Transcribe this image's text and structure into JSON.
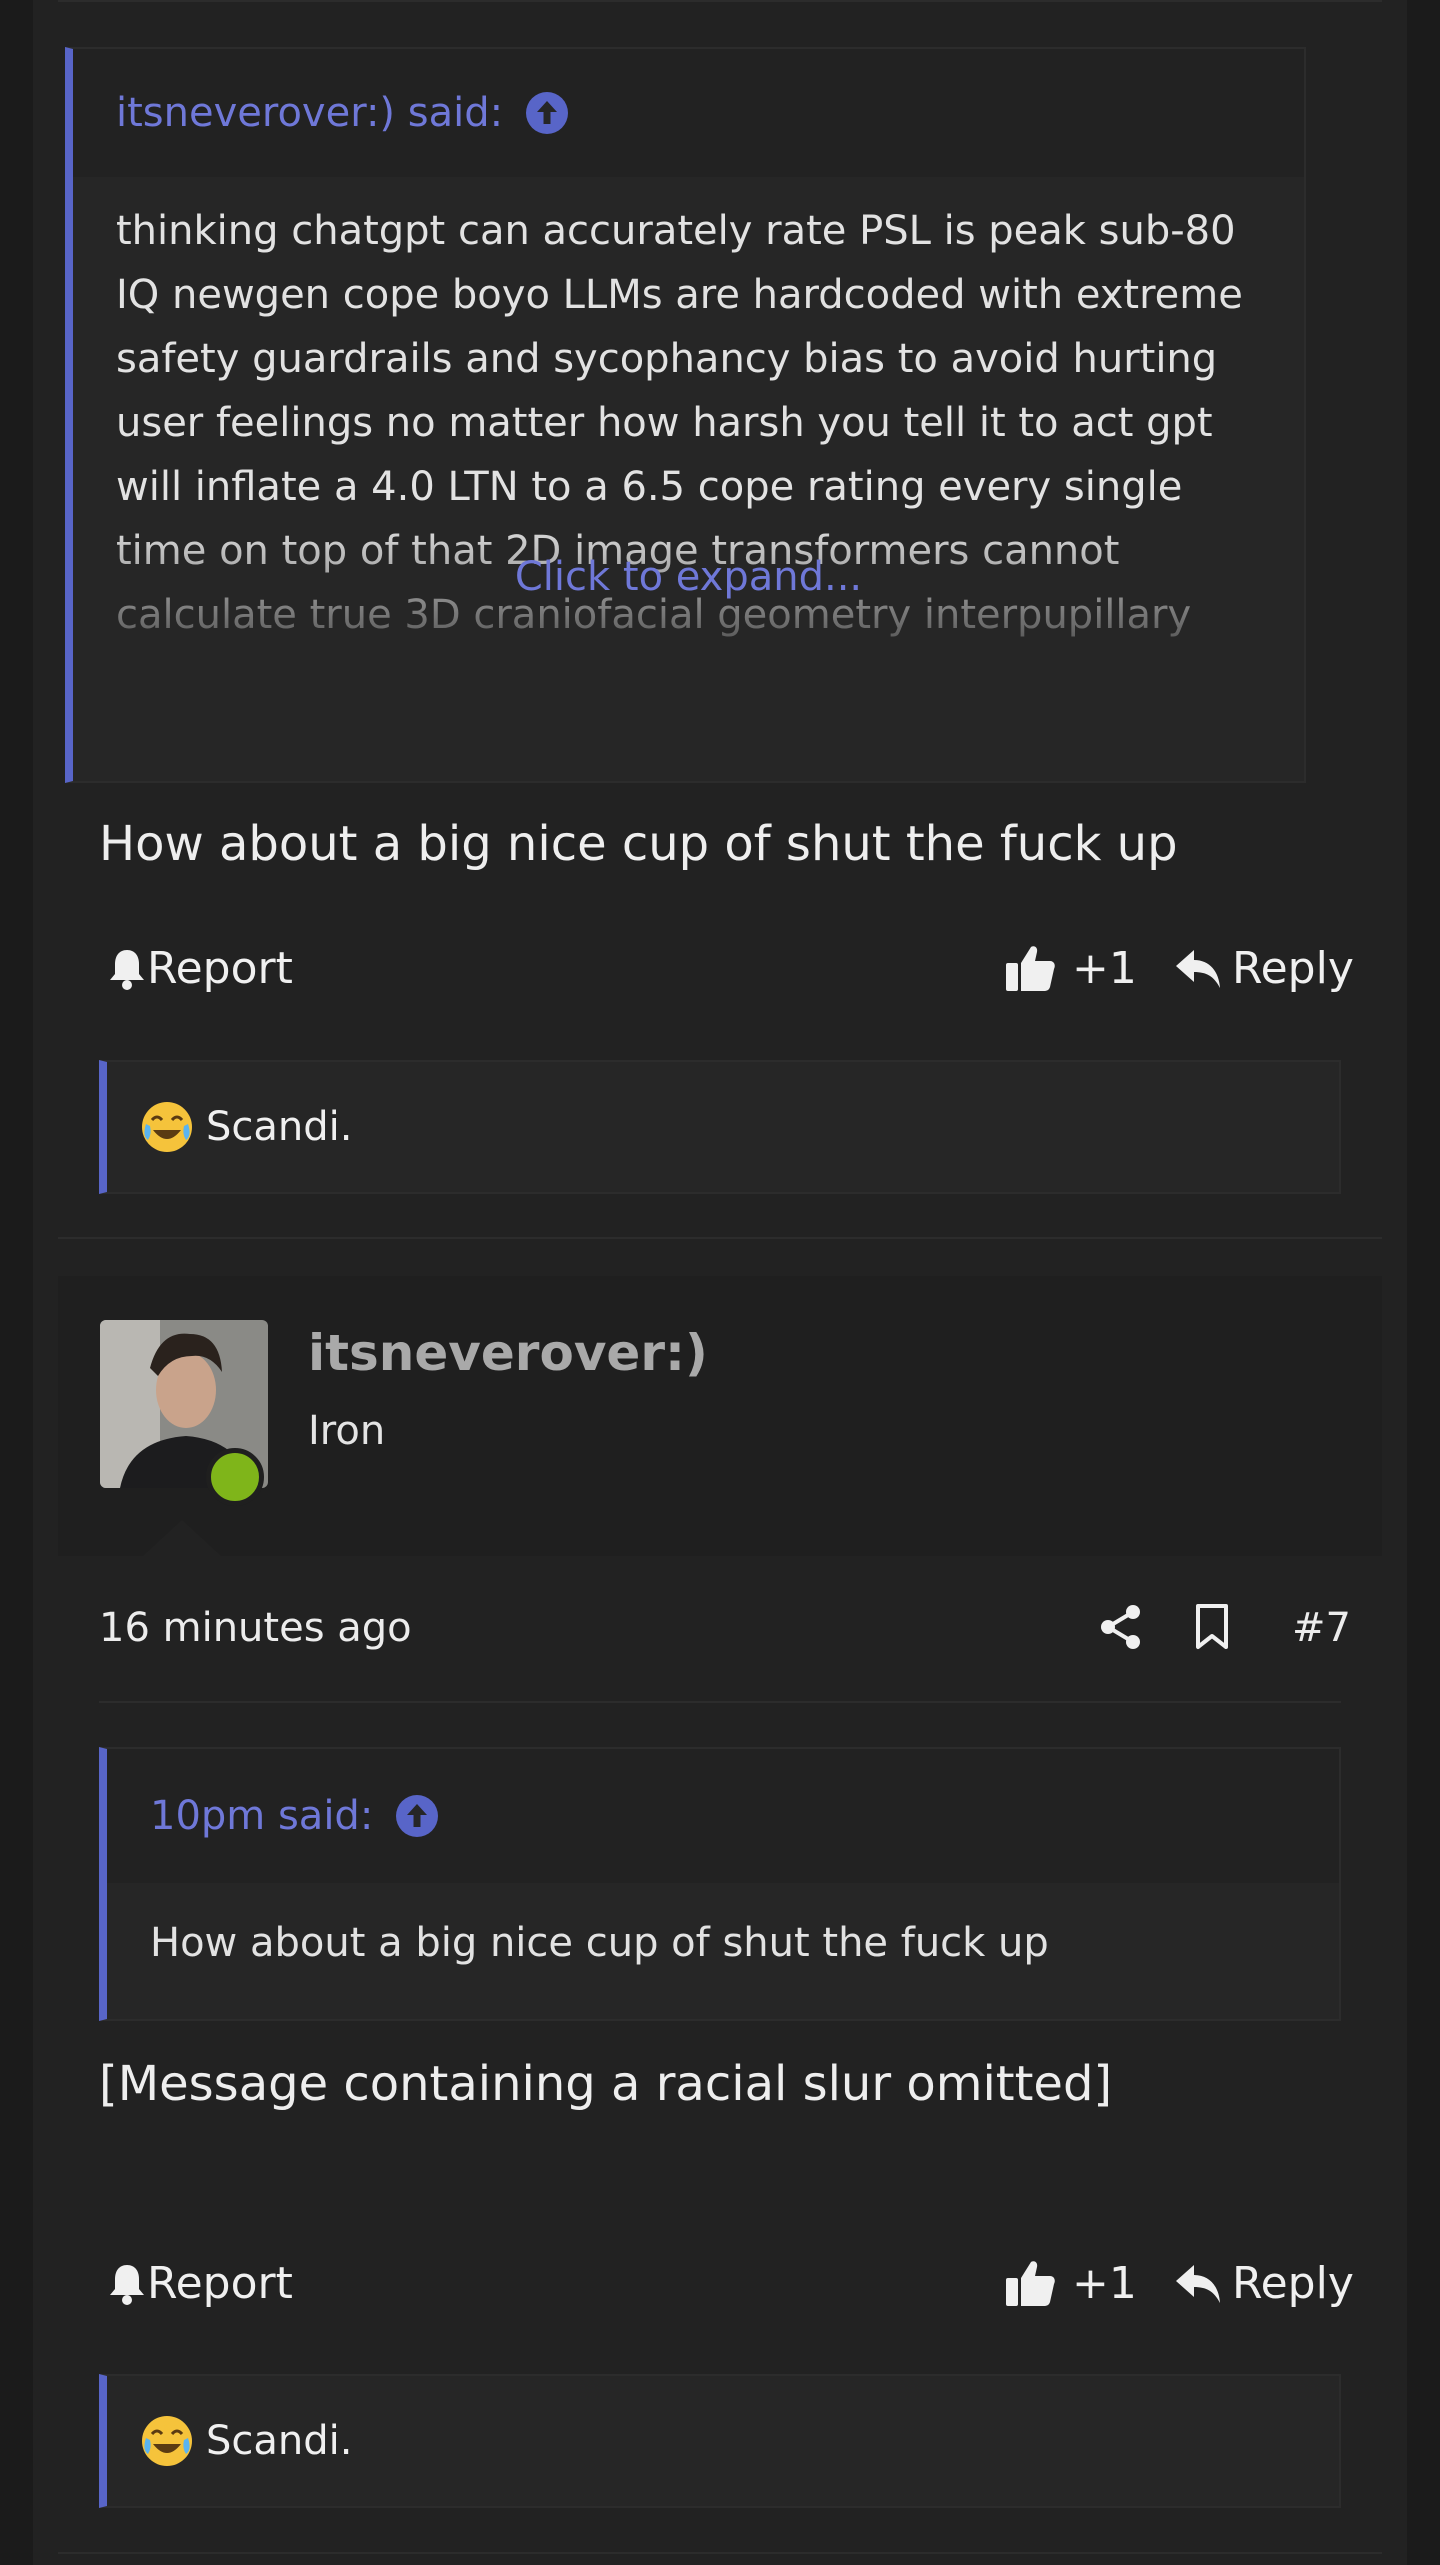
{
  "post1": {
    "quote": {
      "author_label": "itsneverover:) said:",
      "text": "thinking chatgpt can accurately rate PSL is peak sub-80 IQ newgen cope boyo LLMs are hardcoded with extreme safety guardrails and sycophancy bias to avoid hurting user feelings no matter how harsh you tell it to act gpt will inflate a 4.0 LTN to a 6.5 cope rating every single time on top of that 2D image transformers cannot calculate true 3D craniofacial geometry interpupillary distance orbital rim support or bizygomatic width from a",
      "expand_label": "Click to expand..."
    },
    "message": "How about a big nice cup of shut the fuck up",
    "actions": {
      "report": "Report",
      "like_count": "+1",
      "reply": "Reply"
    },
    "reactions": {
      "names": "Scandi."
    }
  },
  "post2": {
    "user": {
      "name": "itsneverover:)",
      "title": "Iron",
      "online": true
    },
    "time": "16 minutes ago",
    "post_number": "#7",
    "quote": {
      "author_label": "10pm said:",
      "text": "How about a big nice cup of shut the fuck up"
    },
    "message": "[Message containing a racial slur omitted]",
    "actions": {
      "report": "Report",
      "like_count": "+1",
      "reply": "Reply"
    },
    "reactions": {
      "names": "Scandi."
    }
  },
  "colors": {
    "accent": "#5865c8",
    "link": "#6f78d8",
    "online": "#7fb51a",
    "background": "#222222"
  },
  "icons": [
    "arrow-up-circle-icon",
    "bell-icon",
    "thumbs-up-icon",
    "reply-icon",
    "share-icon",
    "bookmark-icon",
    "crying-laughing-emoji"
  ]
}
